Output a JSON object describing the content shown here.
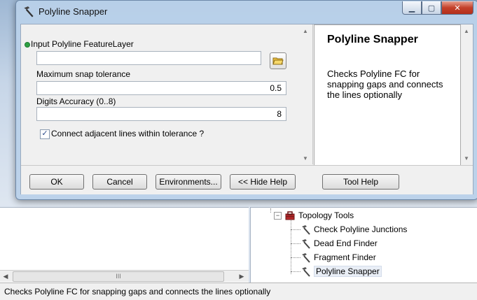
{
  "dialog": {
    "title": "Polyline Snapper",
    "input_label": "Input Polyline FeatureLayer",
    "input_value": "",
    "tolerance_label": "Maximum snap tolerance",
    "tolerance_value": "0.5",
    "digits_label": "Digits Accuracy (0..8)",
    "digits_value": "8",
    "connect_label": "Connect adjacent lines within tolerance ?",
    "connect_checked": true,
    "help_title": "Polyline Snapper",
    "help_text": "Checks Polyline FC for snapping gaps and connects the lines optionally",
    "buttons": {
      "ok": "OK",
      "cancel": "Cancel",
      "environments": "Environments...",
      "hide_help": "<< Hide Help",
      "tool_help": "Tool Help"
    }
  },
  "toolbox": {
    "group": "Topology Tools",
    "tools": [
      "Check Polyline Junctions",
      "Dead End Finder",
      "Fragment Finder",
      "Polyline Snapper"
    ],
    "selected": "Polyline Snapper"
  },
  "scrollbar_thumb": "III",
  "status_text": "Checks Polyline FC for snapping gaps and connects the lines optionally",
  "colors": {
    "title_bar": "#b9d1ea",
    "close_button": "#c4402a",
    "required_dot": "#2ea043"
  }
}
